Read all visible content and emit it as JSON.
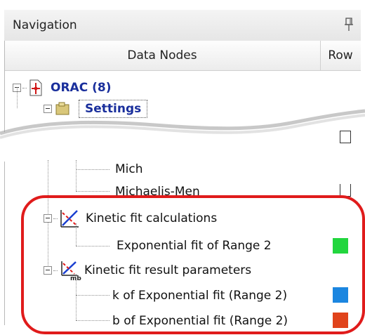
{
  "panel": {
    "title": "Navigation"
  },
  "columns": {
    "data_nodes": "Data Nodes",
    "row": "Row"
  },
  "tree": {
    "root_label": "ORAC (8)",
    "settings_label": "Settings",
    "mich_partial_1": "Mich",
    "mich_partial_2": "Michaelis-Men",
    "kinetic_calc": "Kinetic fit calculations",
    "exp_fit": "Exponential fit of Range 2",
    "kinetic_params": "Kinetic fit result parameters",
    "k_param": "k of Exponential fit (Range 2)",
    "b_param": "b of Exponential fit (Range 2)"
  },
  "colors": {
    "exp_fit_swatch": "#22d63e",
    "k_swatch": "#1b86e0",
    "b_swatch": "#e0431b",
    "highlight": "#e01b1b"
  },
  "icons": [
    "pin-icon",
    "orac-icon",
    "settings-icon",
    "kinetic-fit-icon",
    "kinetic-params-icon"
  ]
}
